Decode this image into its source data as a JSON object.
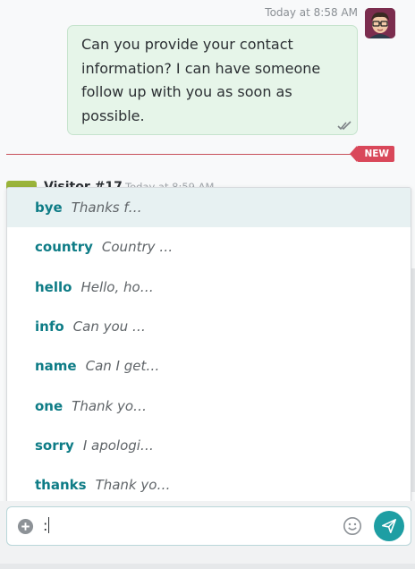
{
  "message": {
    "timestamp": "Today at 8:58 AM",
    "lines": [
      "Can you provide your contact",
      "information? I can have someone",
      "follow up with you as soon as",
      "possible."
    ],
    "status_icon": "double-check-icon"
  },
  "divider": {
    "badge": "NEW"
  },
  "next_message": {
    "author": "Visitor #17",
    "timestamp": "Today at 8:59 AM"
  },
  "suggestions": [
    {
      "key": "bye",
      "preview": "Thanks f…"
    },
    {
      "key": "country",
      "preview": "Country …"
    },
    {
      "key": "hello",
      "preview": "Hello, ho…"
    },
    {
      "key": "info",
      "preview": "Can you …"
    },
    {
      "key": "name",
      "preview": "Can I get…"
    },
    {
      "key": "one",
      "preview": "Thank yo…"
    },
    {
      "key": "sorry",
      "preview": "I apologi…"
    },
    {
      "key": "thanks",
      "preview": "Thank yo…"
    }
  ],
  "composer": {
    "value": ":",
    "add_icon": "plus-circle-icon",
    "emoji_icon": "smiley-icon",
    "send_icon": "paper-plane-icon"
  },
  "colors": {
    "accent": "#0e7c86",
    "send": "#1e9ea3",
    "bubble": "#e6f5e9",
    "new_badge": "#d9485a"
  }
}
